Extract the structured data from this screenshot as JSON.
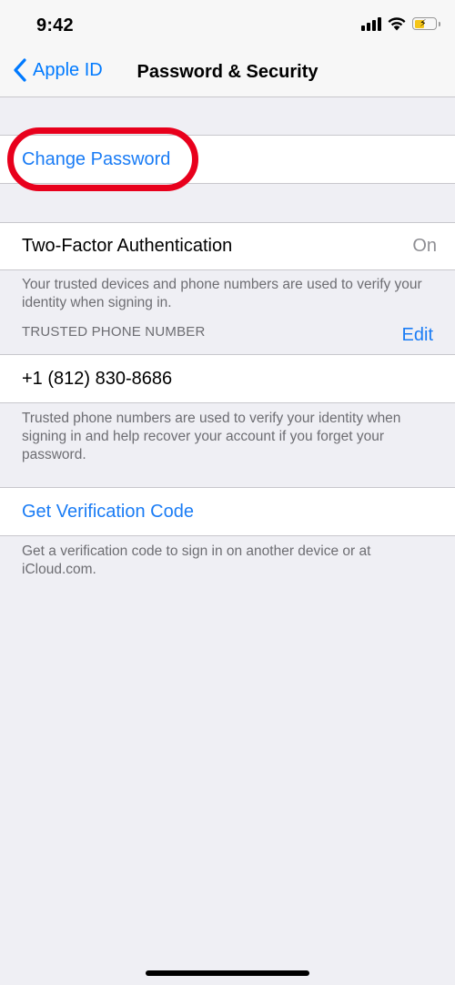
{
  "status_bar": {
    "time": "9:42",
    "icons": [
      "cellular-signal-icon",
      "wifi-icon",
      "battery-charging-icon"
    ],
    "battery_color": "#f5c518"
  },
  "nav": {
    "back_label": "Apple ID",
    "title": "Password & Security"
  },
  "change_password": {
    "label": "Change Password",
    "highlight_color": "#e8001c"
  },
  "two_factor": {
    "label": "Two-Factor Authentication",
    "value": "On",
    "footer": "Your trusted devices and phone numbers are used to verify your identity when signing in."
  },
  "trusted_phone": {
    "header": "TRUSTED PHONE NUMBER",
    "edit_label": "Edit",
    "number": "+1 (812) 830-8686",
    "footer": "Trusted phone numbers are used to verify your identity when signing in and help recover your account if you forget your password."
  },
  "verification": {
    "label": "Get Verification Code",
    "footer": "Get a verification code to sign in on another device or at iCloud.com."
  },
  "colors": {
    "accent": "#1a7cf5",
    "background": "#efeff4",
    "secondary_text": "#6d6d72"
  }
}
